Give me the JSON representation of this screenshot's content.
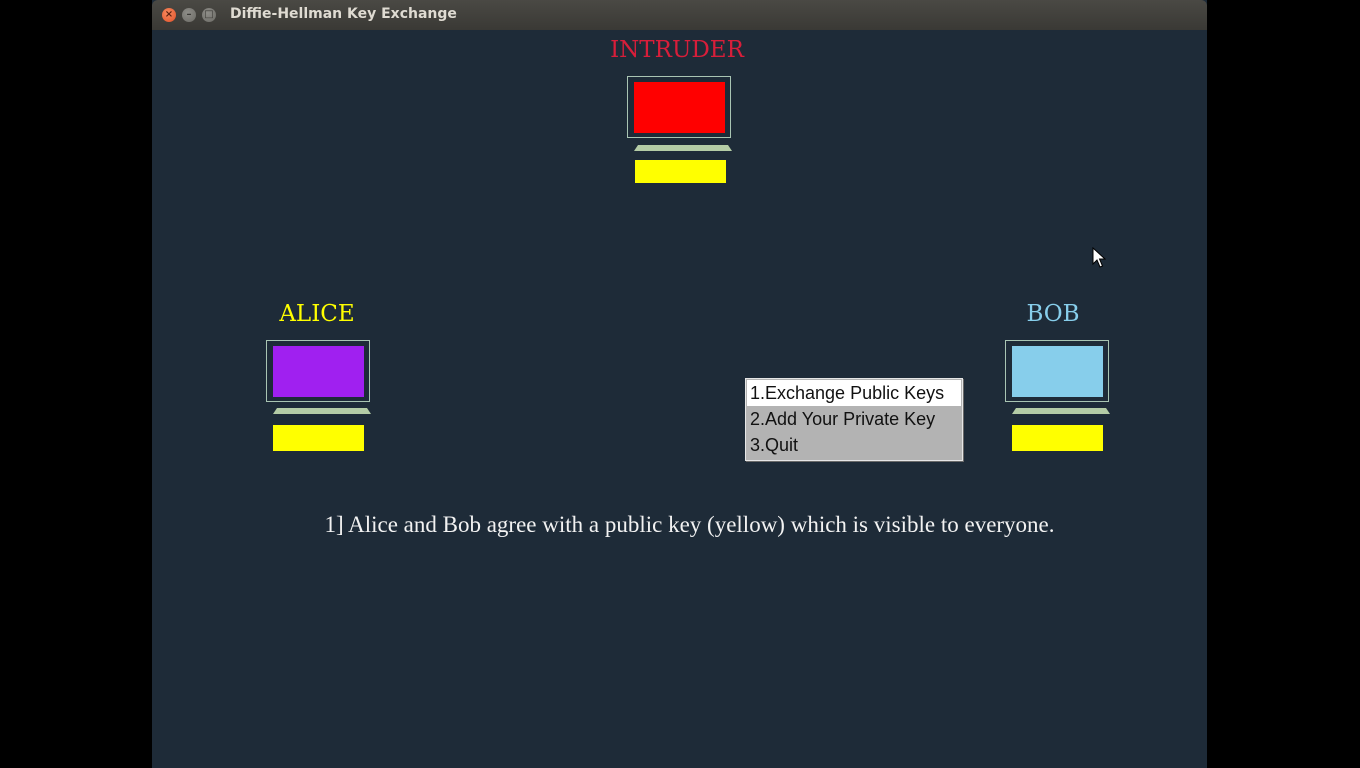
{
  "window": {
    "title": "Diffie-Hellman Key Exchange",
    "controls": {
      "close": "×",
      "minimize": "–",
      "maximize": "□"
    }
  },
  "nodes": {
    "intruder": {
      "label": "INTRUDER",
      "label_color": "#d81e3a",
      "screen_color": "#ff0000"
    },
    "alice": {
      "label": "ALICE",
      "label_color": "#ffff00",
      "screen_color": "#a020f0"
    },
    "bob": {
      "label": "BOB",
      "label_color": "#87ceeb",
      "screen_color": "#87ceeb"
    }
  },
  "public_key_color": "#ffff00",
  "menu": {
    "items": [
      {
        "label": "1.Exchange Public Keys",
        "active": true
      },
      {
        "label": "2.Add Your Private Key",
        "active": false
      },
      {
        "label": "3.Quit",
        "active": false
      }
    ]
  },
  "caption": "1] Alice and Bob agree with a public key (yellow) which is visible to everyone.",
  "icons": {
    "cursor": "mouse-pointer-icon"
  }
}
